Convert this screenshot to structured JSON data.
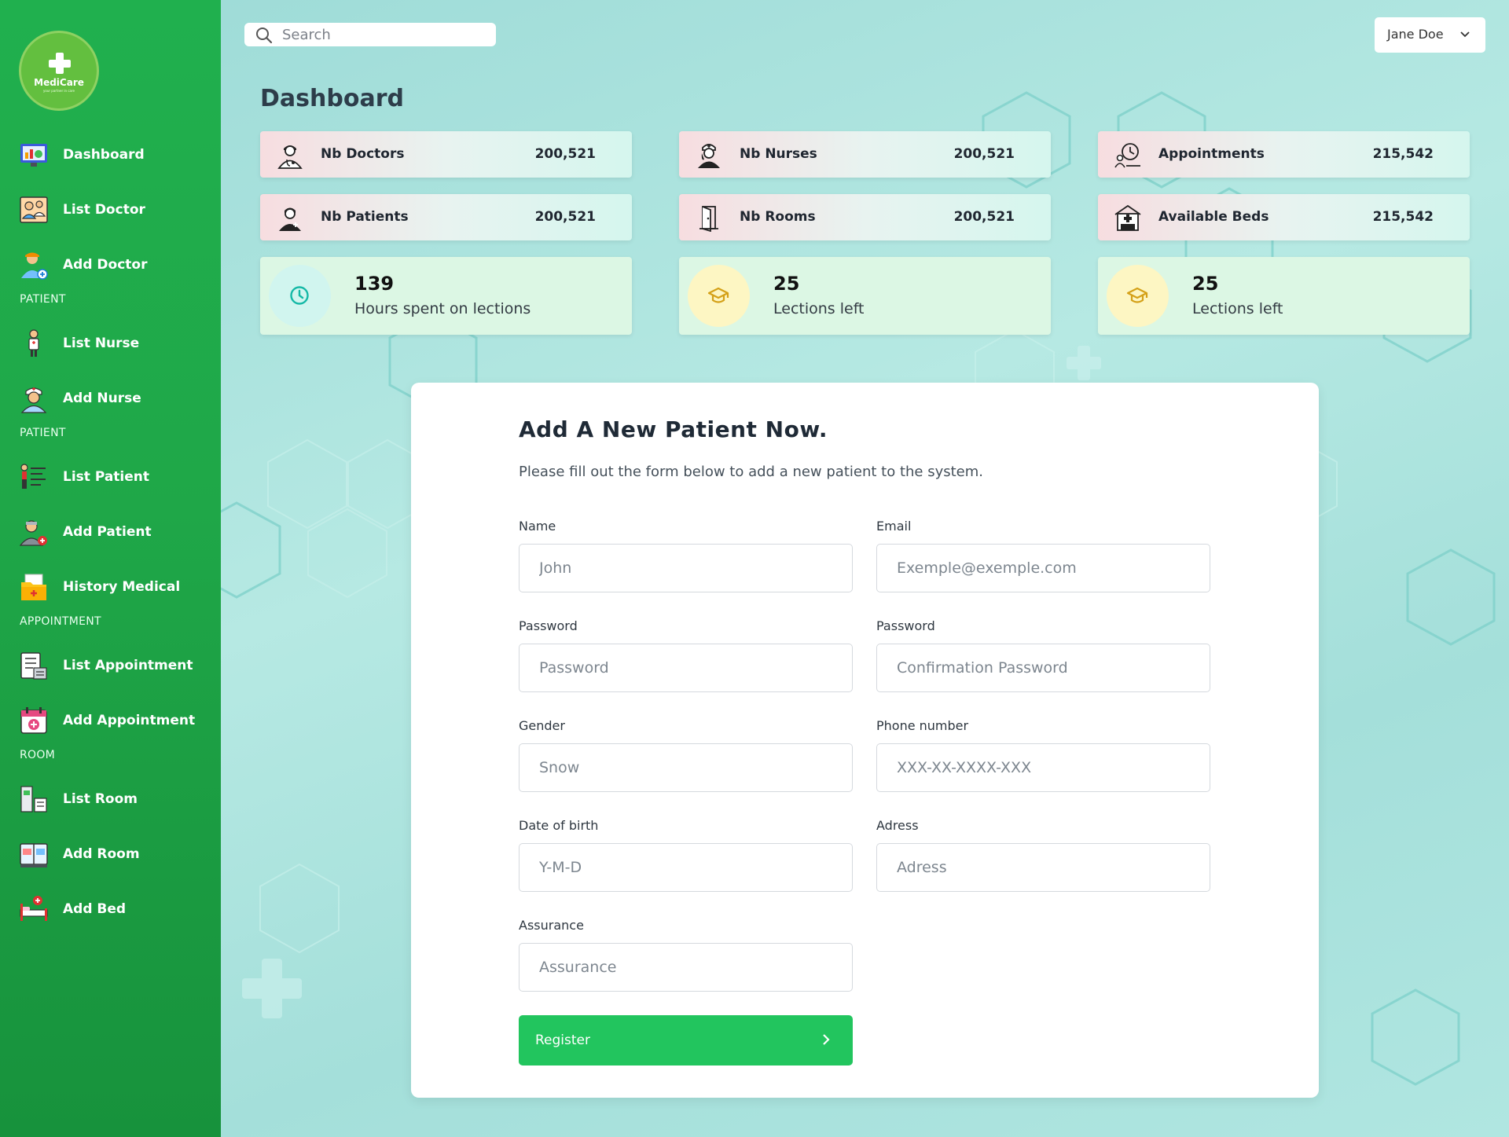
{
  "app": {
    "logo_name": "MediCare",
    "logo_tagline": "your partner in care"
  },
  "sidebar": {
    "items": [
      {
        "label": "Dashboard",
        "icon": "dashboard-icon"
      },
      {
        "label": "List Doctor",
        "icon": "doctor-list-icon"
      },
      {
        "label": "Add Doctor",
        "icon": "add-doctor-icon"
      },
      {
        "label": "List Nurse",
        "icon": "nurse-list-icon"
      },
      {
        "label": "Add Nurse",
        "icon": "add-nurse-icon"
      },
      {
        "label": "List Patient",
        "icon": "patient-list-icon"
      },
      {
        "label": "Add Patient",
        "icon": "add-patient-icon"
      },
      {
        "label": "History Medical",
        "icon": "medical-history-icon"
      },
      {
        "label": "List Appointment",
        "icon": "appointment-list-icon"
      },
      {
        "label": "Add Appointment",
        "icon": "add-appointment-icon"
      },
      {
        "label": "List Room",
        "icon": "room-list-icon"
      },
      {
        "label": "Add Room",
        "icon": "add-room-icon"
      },
      {
        "label": "Add Bed",
        "icon": "add-bed-icon"
      }
    ],
    "sections": [
      "PATIENT",
      "PATIENT",
      "APPOINTMENT",
      "ROOM"
    ]
  },
  "topbar": {
    "search_placeholder": "Search",
    "user_name": "Jane Doe"
  },
  "page": {
    "title": "Dashboard"
  },
  "stats": [
    {
      "label": "Nb Doctors",
      "value": "200,521",
      "icon": "doctor-icon"
    },
    {
      "label": "Nb Nurses",
      "value": "200,521",
      "icon": "nurse-icon"
    },
    {
      "label": "Appointments",
      "value": "215,542",
      "icon": "appointment-icon"
    },
    {
      "label": "Nb Patients",
      "value": "200,521",
      "icon": "patient-icon"
    },
    {
      "label": "Nb Rooms",
      "value": "200,521",
      "icon": "door-icon"
    },
    {
      "label": "Available Beds",
      "value": "215,542",
      "icon": "hospital-icon"
    }
  ],
  "info_cards": [
    {
      "value": "139",
      "label": "Hours spent on lections",
      "icon": "clock-icon",
      "badge_color": "#d1f5ef",
      "icon_color": "#14b8a6"
    },
    {
      "value": "25",
      "label": "Lections left",
      "icon": "graduation-cap-icon",
      "badge_color": "#fdf6c3",
      "icon_color": "#d4a017"
    },
    {
      "value": "25",
      "label": "Lections left",
      "icon": "graduation-cap-icon",
      "badge_color": "#fdf6c3",
      "icon_color": "#d4a017"
    }
  ],
  "form": {
    "title": "Add A New Patient Now.",
    "subtitle": "Please fill out the form below to add a new patient to the system.",
    "fields": {
      "name": {
        "label": "Name",
        "placeholder": "John"
      },
      "email": {
        "label": "Email",
        "placeholder": "Exemple@exemple.com"
      },
      "password": {
        "label": "Password",
        "placeholder": "Password"
      },
      "password_confirm": {
        "label": "Password",
        "placeholder": "Confirmation Password"
      },
      "gender": {
        "label": "Gender",
        "placeholder": "Snow"
      },
      "phone": {
        "label": "Phone number",
        "placeholder": "XXX-XX-XXXX-XXX"
      },
      "dob": {
        "label": "Date of birth",
        "placeholder": "Y-M-D"
      },
      "address": {
        "label": "Adress",
        "placeholder": "Adress"
      },
      "assurance": {
        "label": "Assurance",
        "placeholder": "Assurance"
      }
    },
    "submit_label": "Register"
  },
  "colors": {
    "sidebar_green": "#1fa748",
    "accent_green": "#22c55e",
    "background_teal": "#a6e0dc"
  }
}
